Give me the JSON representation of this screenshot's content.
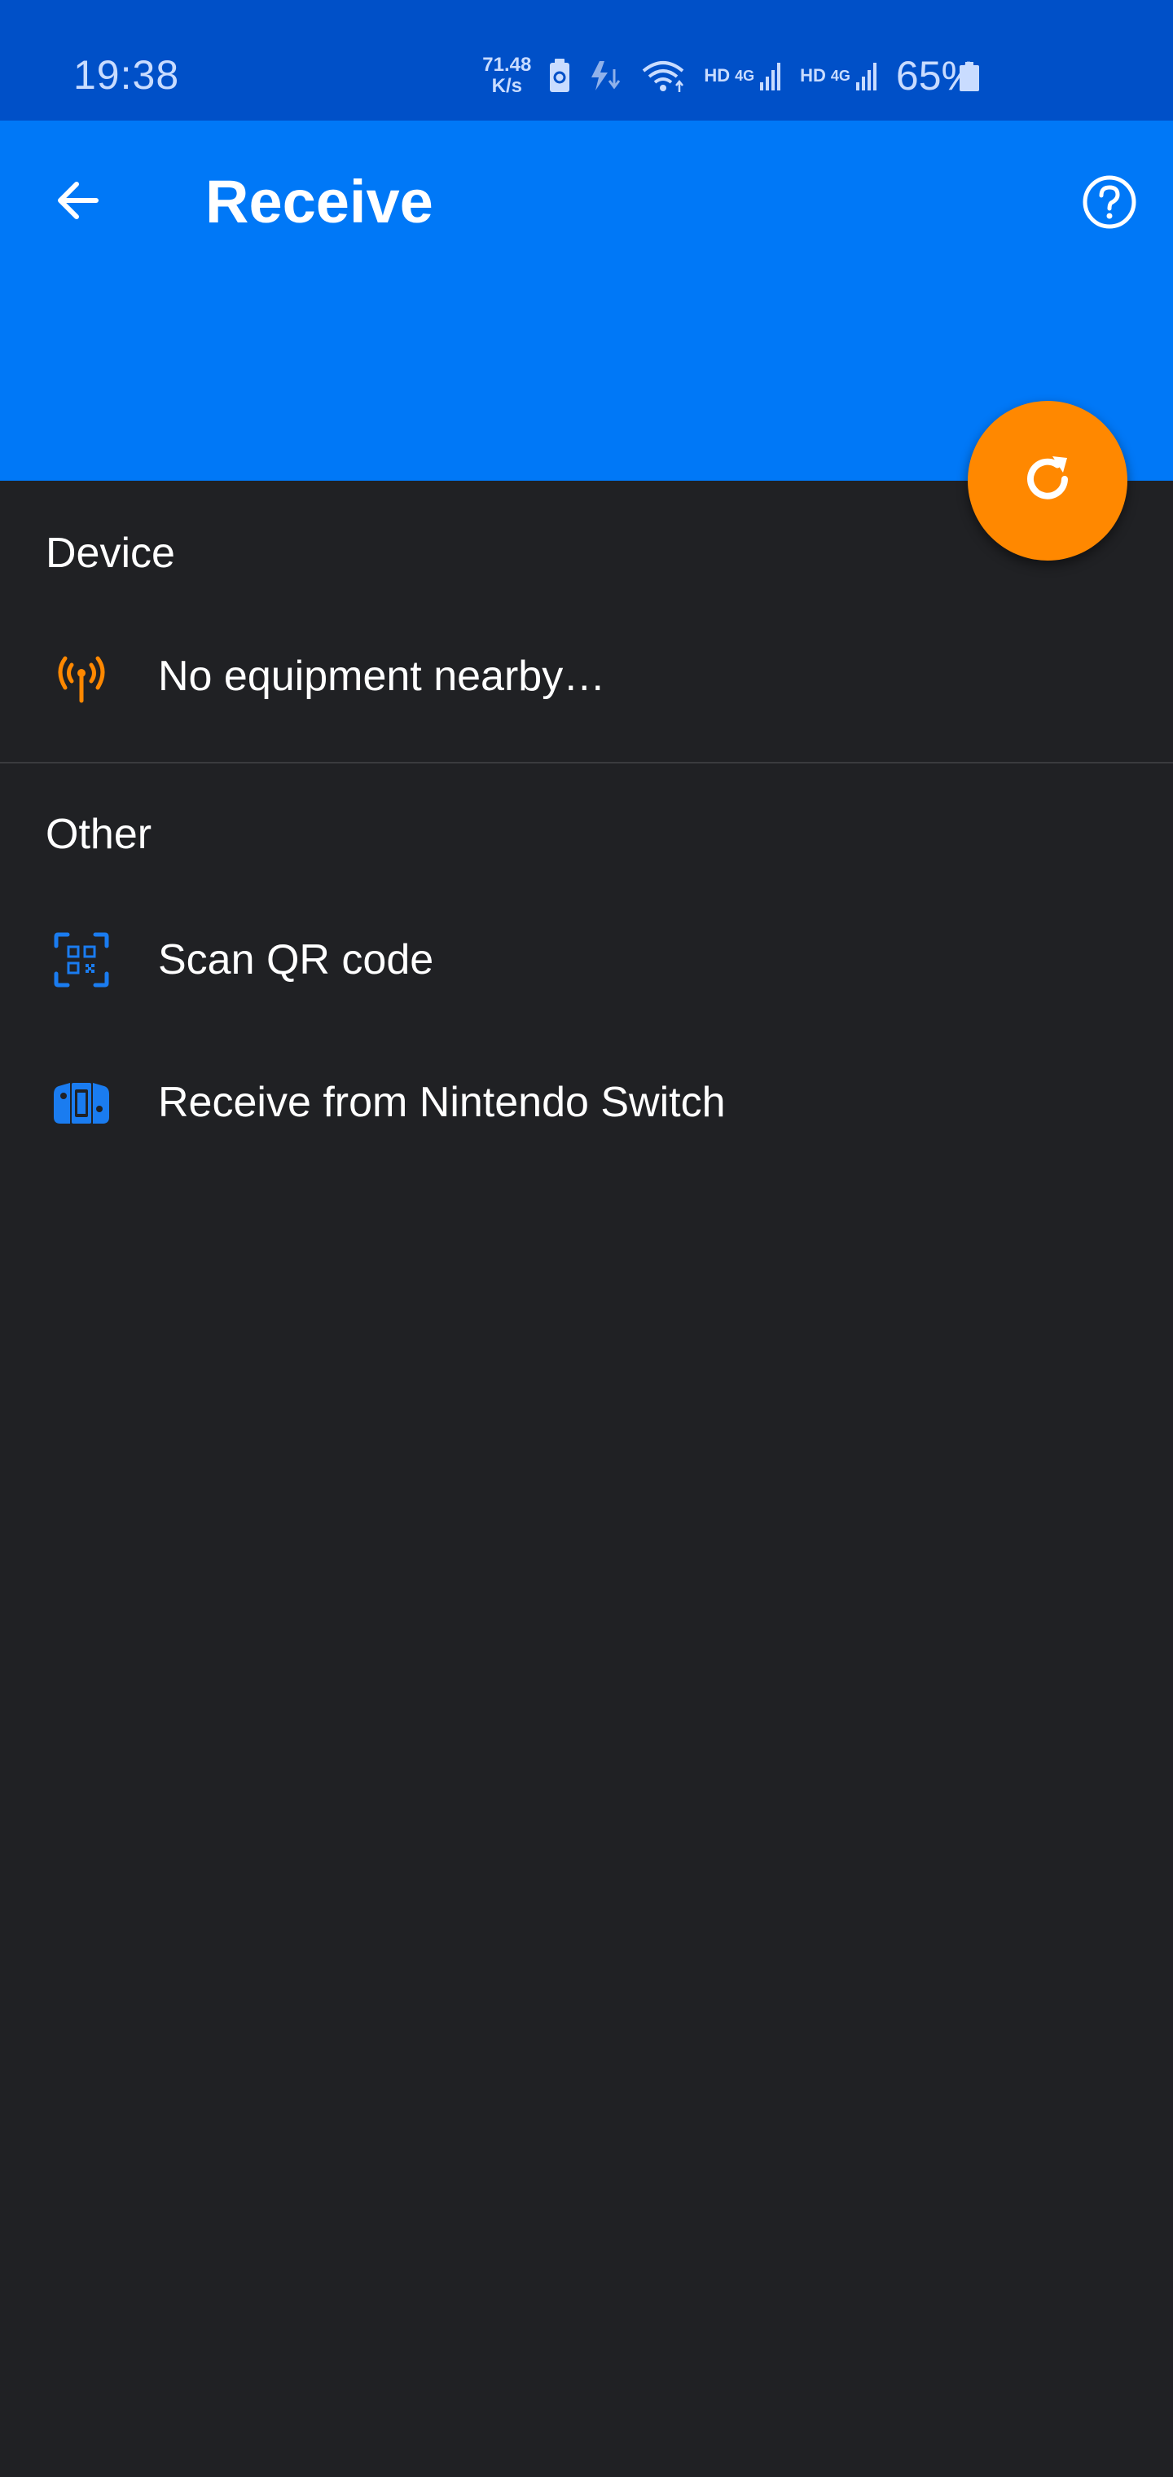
{
  "status_bar": {
    "time": "19:38",
    "speed_value": "71.48",
    "speed_unit": "K/s",
    "net1": "HD",
    "net1_type": "4G",
    "net2": "HD",
    "net2_type": "4G",
    "battery": "65%"
  },
  "app_bar": {
    "title": "Receive",
    "back_icon": "arrow-back-icon",
    "help_icon": "help-circle-icon"
  },
  "fab": {
    "icon": "refresh-icon"
  },
  "sections": {
    "device": {
      "header": "Device",
      "empty_label": "No equipment nearby…"
    },
    "other": {
      "header": "Other",
      "items": [
        {
          "label": "Scan QR code",
          "icon": "qr-scan-icon"
        },
        {
          "label": "Receive from Nintendo Switch",
          "icon": "nintendo-switch-icon"
        }
      ]
    }
  },
  "colors": {
    "status_bar": "#0050c8",
    "app_bar": "#0078f7",
    "fab": "#ff8800",
    "background": "#202124",
    "accent_blue": "#1a7cf0",
    "accent_orange": "#ff8800"
  }
}
